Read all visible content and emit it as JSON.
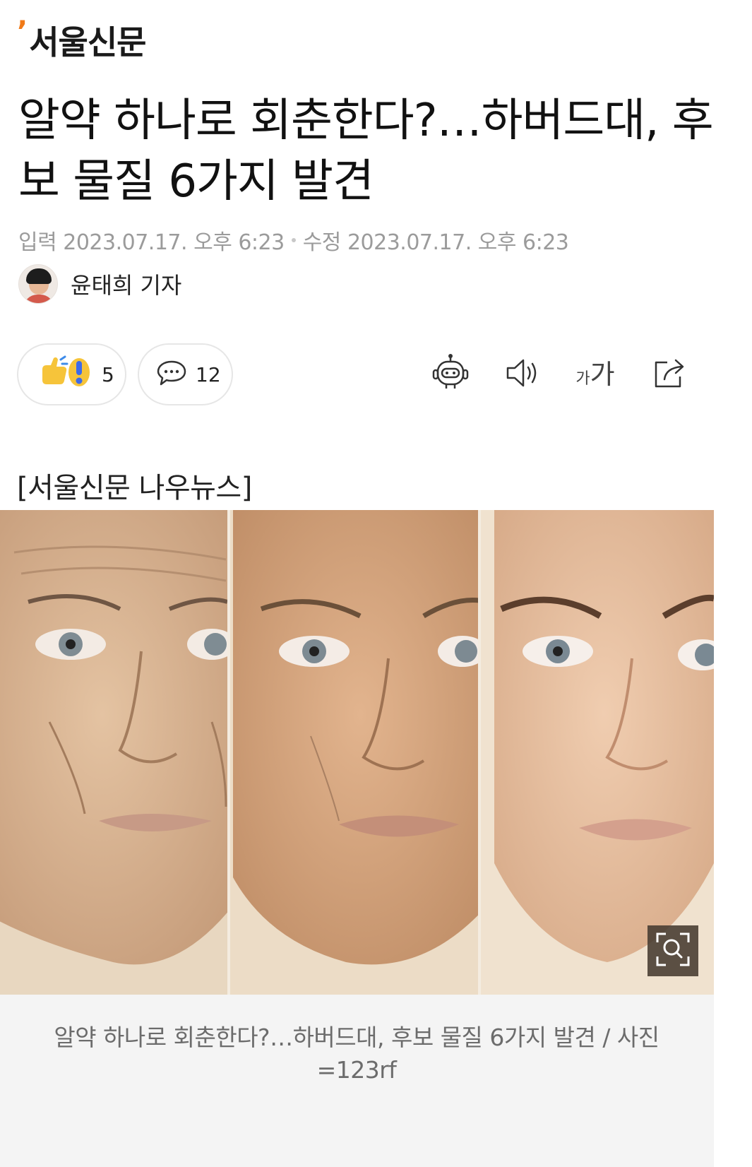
{
  "brand": {
    "logo_text": "서울신문",
    "accent_color": "#f07a18"
  },
  "article": {
    "title": "알약 하나로 회춘한다?…하버드대, 후보 물질 6가지 발견",
    "published_label": "입력",
    "published_time": "2023.07.17. 오후 6:23",
    "modified_label": "수정",
    "modified_time": "2023.07.17. 오후 6:23",
    "reporter": "윤태희 기자",
    "source": "[서울신문 나우뉴스]",
    "image_caption": "알약 하나로 회춘한다?…하버드대, 후보 물질 6가지 발견 / 사진=123rf"
  },
  "actions": {
    "reaction_count": "5",
    "comment_count": "12",
    "font_icon_small": "가",
    "font_icon_big": "가"
  },
  "icons": {
    "reaction": "reaction-emoji-icon",
    "comment": "speech-bubble-icon",
    "summary": "robot-icon",
    "tts": "speaker-icon",
    "font": "font-size-icon",
    "share": "share-icon",
    "zoom": "zoom-icon"
  }
}
